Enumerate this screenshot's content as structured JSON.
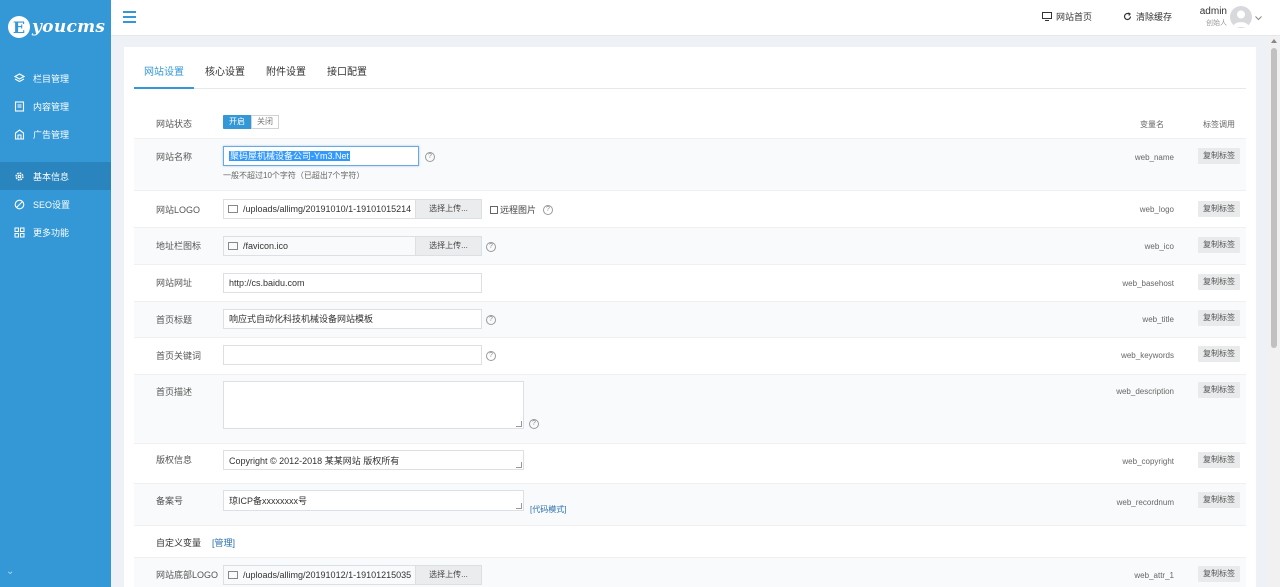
{
  "brand": {
    "logo_letter": "E",
    "logo_text": "youcms"
  },
  "sidebar": {
    "items": [
      {
        "label": "栏目管理",
        "icon": "layers-icon"
      },
      {
        "label": "内容管理",
        "icon": "document-icon"
      },
      {
        "label": "广告管理",
        "icon": "ad-icon"
      },
      {
        "label": "基本信息",
        "icon": "gear-icon",
        "active": true
      },
      {
        "label": "SEO设置",
        "icon": "seo-icon"
      },
      {
        "label": "更多功能",
        "icon": "grid-icon"
      }
    ],
    "footer": "⌄"
  },
  "topbar": {
    "home_label": "网站首页",
    "clear_cache_label": "清除缓存",
    "user_name": "admin",
    "user_role": "创始人"
  },
  "tabs": [
    "网站设置",
    "核心设置",
    "附件设置",
    "接口配置"
  ],
  "columns": {
    "var_header": "变量名",
    "tag_header": "标签调用"
  },
  "copy_label": "复制标签",
  "help_glyph": "?",
  "fields": {
    "status": {
      "label": "网站状态",
      "on": "开启",
      "off": "关闭"
    },
    "name": {
      "label": "网站名称",
      "value": "聚码屋机械设备公司-Ym3.Net",
      "hint": "一般不超过10个字符（已超出7个字符）",
      "var": "web_name"
    },
    "logo": {
      "label": "网站LOGO",
      "value": "/uploads/allimg/20191010/1-19101015214",
      "button": "选择上传...",
      "remote": "远程图片",
      "var": "web_logo"
    },
    "ico": {
      "label": "地址栏图标",
      "value": "/favicon.ico",
      "button": "选择上传...",
      "var": "web_ico"
    },
    "url": {
      "label": "网站网址",
      "value": "http://cs.baidu.com",
      "var": "web_basehost"
    },
    "title": {
      "label": "首页标题",
      "value": "响应式自动化科技机械设备网站模板",
      "var": "web_title"
    },
    "keywords": {
      "label": "首页关键词",
      "value": "",
      "var": "web_keywords"
    },
    "description": {
      "label": "首页描述",
      "value": "",
      "var": "web_description"
    },
    "copyright": {
      "label": "版权信息",
      "value": "Copyright © 2012-2018 某某网站 版权所有",
      "var": "web_copyright"
    },
    "record": {
      "label": "备案号",
      "value": "琼ICP备xxxxxxxx号",
      "link": "[代码模式]",
      "var": "web_recordnum"
    },
    "custom": {
      "label": "自定义变量",
      "link": "[管理]"
    },
    "footer_logo": {
      "label": "网站底部LOGO",
      "value": "/uploads/allimg/20191012/1-19101215035",
      "button": "选择上传...",
      "var": "web_attr_1"
    }
  }
}
